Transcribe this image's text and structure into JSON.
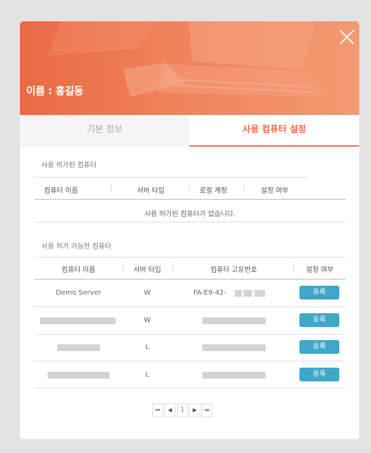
{
  "header": {
    "title": "이름 : 홍길동"
  },
  "tabs": [
    {
      "label": "기본 정보"
    },
    {
      "label": "사용 컴퓨터 설정"
    }
  ],
  "allowed": {
    "title": "사용 허가된 컴퓨터",
    "columns": [
      "컴퓨터 이름",
      "서버 타입",
      "로컬 계정",
      "설정 여부"
    ],
    "empty_message": "사용 허가된 컴퓨터가 없습니다."
  },
  "available": {
    "title": "사용 허가 가능한 컴퓨터",
    "columns": [
      "컴퓨터 이름",
      "서버 타입",
      "컴퓨터 고유번호",
      "설정 여부"
    ],
    "rows": [
      {
        "name": "Demo Server",
        "type": "W",
        "id": "FA-E9-42-",
        "action": "등록"
      },
      {
        "name": "",
        "type": "W",
        "id": "",
        "action": "등록"
      },
      {
        "name": "",
        "type": "L",
        "id": "",
        "action": "등록"
      },
      {
        "name": "",
        "type": "L",
        "id": "",
        "action": "등록"
      }
    ]
  },
  "pagination": {
    "first": "⏮",
    "prev": "◀",
    "current": "1",
    "next": "▶",
    "last": "⏭"
  },
  "colors": {
    "accent": "#f26b45",
    "button": "#3fa7c8"
  }
}
